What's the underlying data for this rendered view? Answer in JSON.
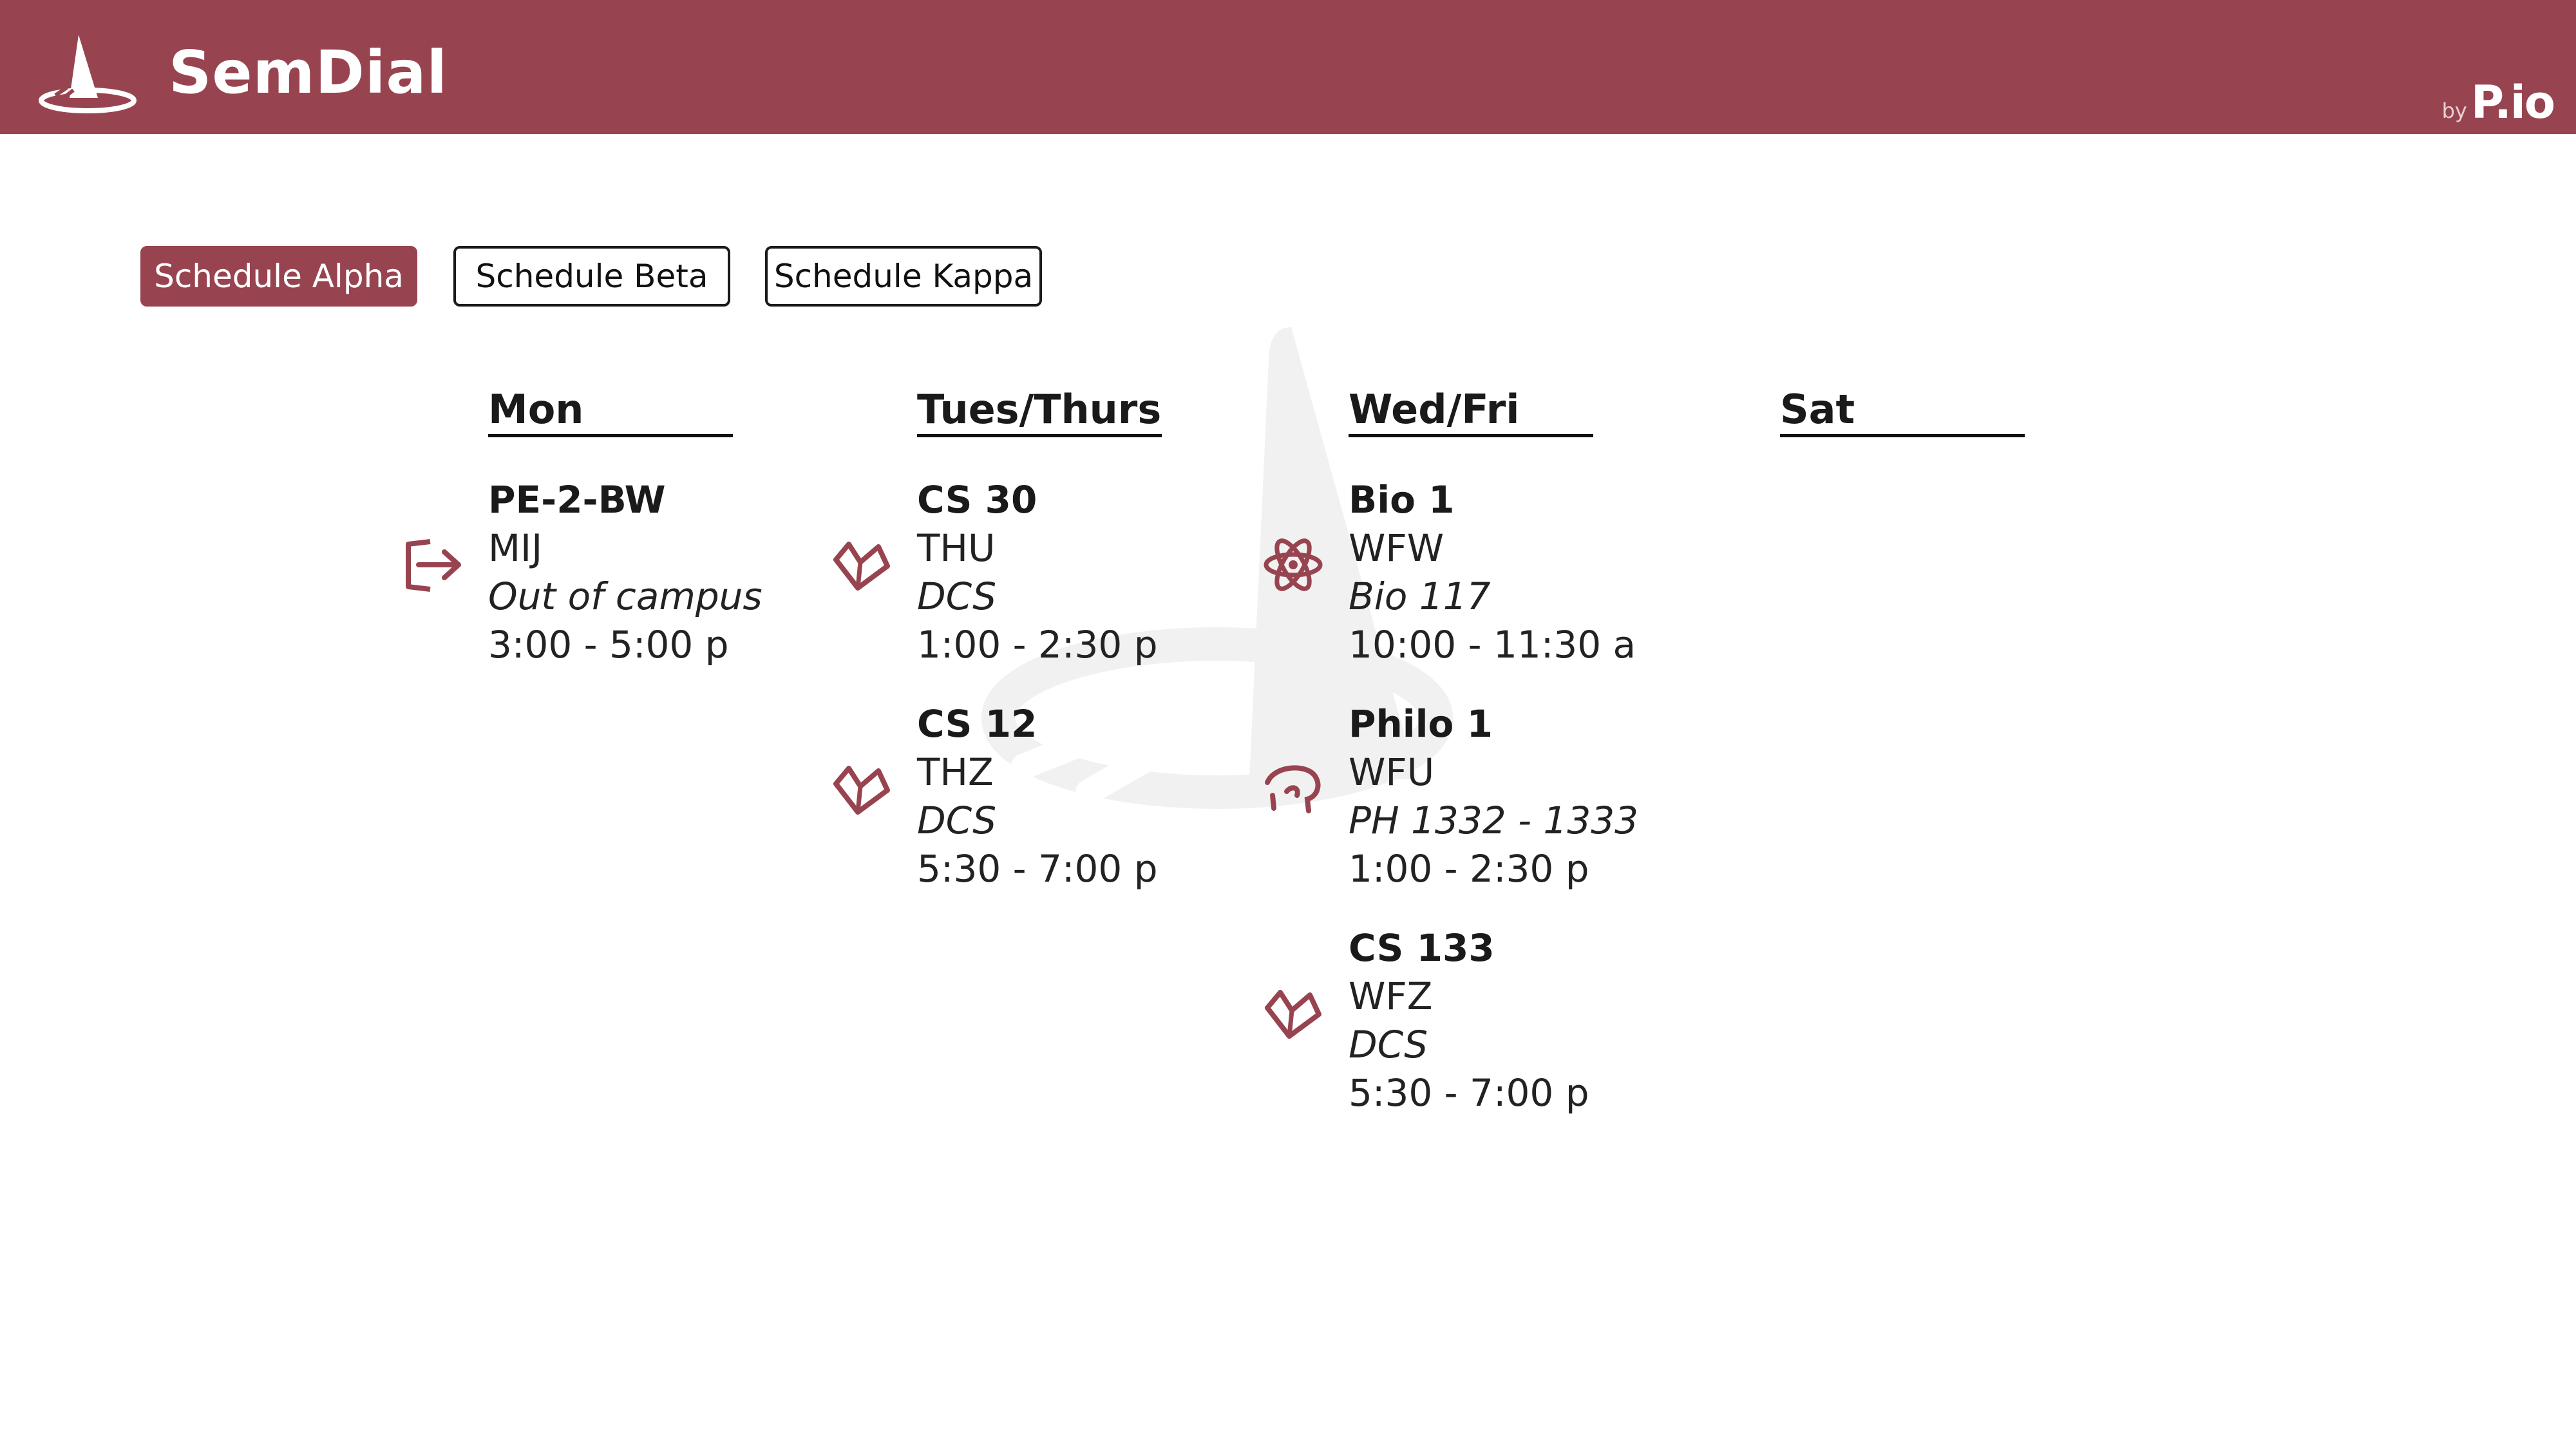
{
  "app": {
    "title": "SemDial",
    "by_label": "by",
    "brand": "P.io",
    "accent": "#984450"
  },
  "tabs": [
    {
      "label": "Schedule Alpha",
      "active": true
    },
    {
      "label": "Schedule Beta",
      "active": false
    },
    {
      "label": "Schedule Kappa",
      "active": false
    }
  ],
  "days": [
    {
      "label": "Mon",
      "courses": [
        {
          "title": "PE-2-BW",
          "section": "MIJ",
          "room": "Out of campus",
          "time": "3:00 - 5:00 p",
          "icon": "exit-icon"
        }
      ]
    },
    {
      "label": "Tues/Thurs",
      "courses": [
        {
          "title": "CS 30",
          "section": "THU",
          "room": "DCS",
          "time": "1:00 - 2:30 p",
          "icon": "book-icon"
        },
        {
          "title": "CS 12",
          "section": "THZ",
          "room": "DCS",
          "time": "5:30 - 7:00 p",
          "icon": "book-icon"
        }
      ]
    },
    {
      "label": "Wed/Fri",
      "courses": [
        {
          "title": "Bio 1",
          "section": "WFW",
          "room": "Bio 117",
          "time": "10:00 - 11:30 a",
          "icon": "atom-icon"
        },
        {
          "title": "Philo 1",
          "section": "WFU",
          "room": "PH 1332 - 1333",
          "time": "1:00 - 2:30 p",
          "icon": "thinker-icon"
        },
        {
          "title": "CS 133",
          "section": "WFZ",
          "room": "DCS",
          "time": "5:30 - 7:00 p",
          "icon": "book-icon"
        }
      ]
    },
    {
      "label": "Sat",
      "courses": []
    }
  ]
}
